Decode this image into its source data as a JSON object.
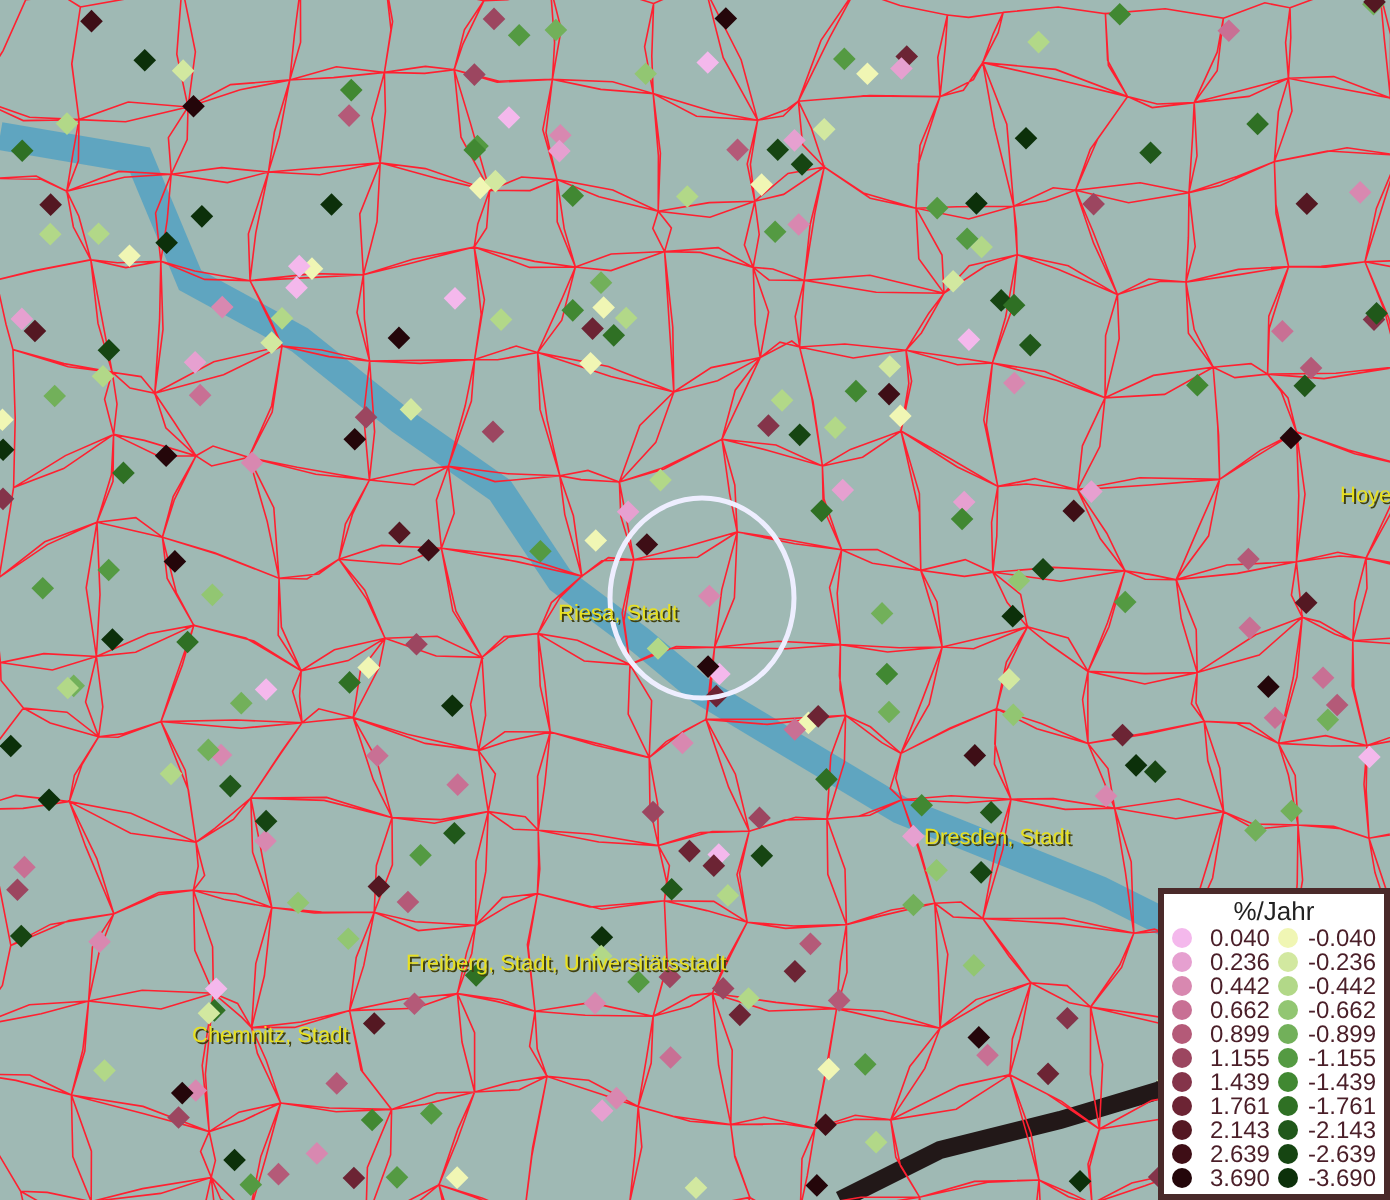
{
  "map": {
    "places": [
      {
        "name": "Riesa, Stadt"
      },
      {
        "name": "Dresden, Stadt"
      },
      {
        "name": "Freiberg, Stadt, Universitätsstadt"
      },
      {
        "name": "Chemnitz, Stadt"
      },
      {
        "name": "Hoye"
      }
    ]
  },
  "legend": {
    "title": "%/Jahr",
    "columns": [
      [
        {
          "label": "0.040",
          "color": "#f4b8ec"
        },
        {
          "label": "0.236",
          "color": "#e6a0d0"
        },
        {
          "label": "0.442",
          "color": "#d888b0"
        },
        {
          "label": "0.662",
          "color": "#c87094"
        },
        {
          "label": "0.899",
          "color": "#b45a78"
        },
        {
          "label": "1.155",
          "color": "#9c4660"
        },
        {
          "label": "1.439",
          "color": "#84344a"
        },
        {
          "label": "1.761",
          "color": "#6c2434"
        },
        {
          "label": "2.143",
          "color": "#541822"
        },
        {
          "label": "2.639",
          "color": "#3e0e16"
        },
        {
          "label": "3.690",
          "color": "#24060a"
        }
      ],
      [
        {
          "label": "-0.040",
          "color": "#f0f6b4"
        },
        {
          "label": "-0.236",
          "color": "#d2e8a0"
        },
        {
          "label": "-0.442",
          "color": "#b2d888"
        },
        {
          "label": "-0.662",
          "color": "#92c672"
        },
        {
          "label": "-0.899",
          "color": "#72b05a"
        },
        {
          "label": "-1.155",
          "color": "#549a42"
        },
        {
          "label": "-1.439",
          "color": "#418832"
        },
        {
          "label": "-1.761",
          "color": "#2f7024"
        },
        {
          "label": "-2.143",
          "color": "#20581a"
        },
        {
          "label": "-2.639",
          "color": "#164512"
        },
        {
          "label": "-3.690",
          "color": "#0c300a"
        }
      ]
    ]
  }
}
